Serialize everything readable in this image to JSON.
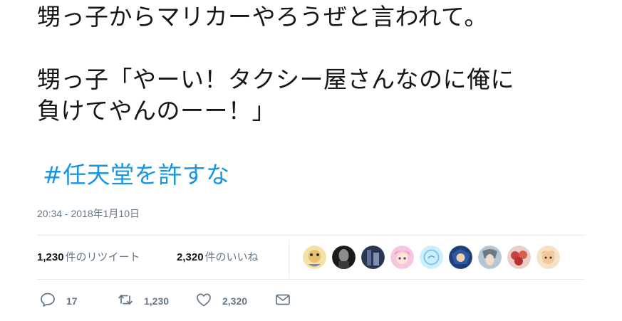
{
  "tweet": {
    "lines": [
      "甥っ子からマリカーやろうぜと言われて。",
      "",
      "甥っ子「やーい！タクシー屋さんなのに俺に",
      "負けてやんのーー！」"
    ],
    "hashtag": "#任天堂を許すな",
    "timestamp": "20:34 - 2018年1月10日"
  },
  "stats": {
    "retweets_count": "1,230",
    "retweets_label": "件のリツイート",
    "likes_count": "2,320",
    "likes_label": "件のいいね"
  },
  "avatars": [
    {
      "name": "avatar-1",
      "color": "#e8c070"
    },
    {
      "name": "avatar-2",
      "color": "#2a2a2a"
    },
    {
      "name": "avatar-3",
      "color": "#3a4a6a"
    },
    {
      "name": "avatar-4",
      "color": "#f2a0c8"
    },
    {
      "name": "avatar-5",
      "color": "#bfe6f7"
    },
    {
      "name": "avatar-6",
      "color": "#2c5aa0"
    },
    {
      "name": "avatar-7",
      "color": "#8aa0b0"
    },
    {
      "name": "avatar-8",
      "color": "#c84040"
    },
    {
      "name": "avatar-9",
      "color": "#e0a868"
    }
  ],
  "actions": {
    "reply_count": "17",
    "retweet_count": "1,230",
    "like_count": "2,320"
  },
  "colors": {
    "link": "#1b95e0",
    "muted": "#657786",
    "text": "#14171a",
    "border": "#e6ecf0"
  }
}
